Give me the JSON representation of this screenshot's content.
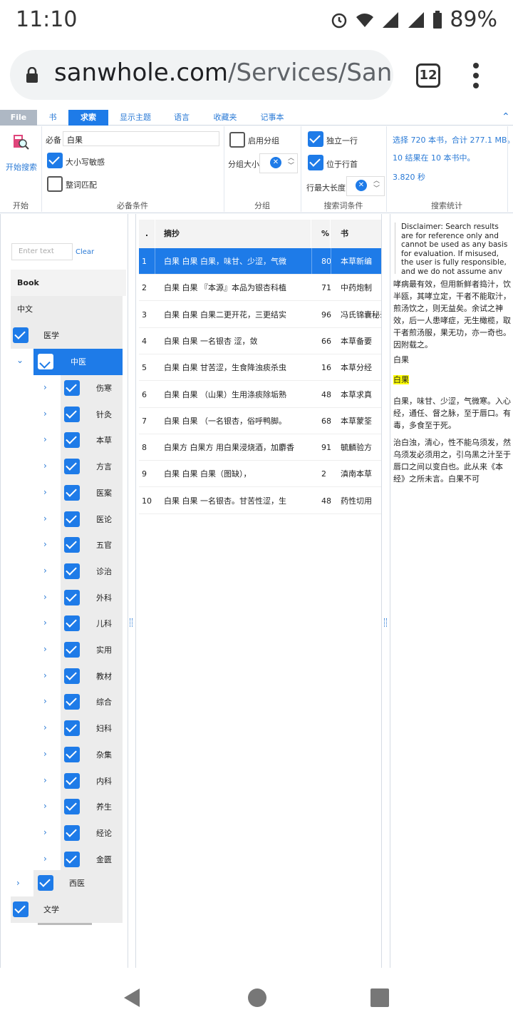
{
  "status": {
    "time": "11:10",
    "battery": "89%"
  },
  "browser": {
    "url_host": "sanwhole.com",
    "url_path": "/Services/San",
    "tab_count": "12"
  },
  "ribbon": {
    "tabs": [
      "File",
      "书",
      "求索",
      "显示主题",
      "语言",
      "收藏夹",
      "记事本"
    ],
    "start": {
      "button_label": "开始搜索",
      "group_label": "开始"
    },
    "required": {
      "field_label": "必备",
      "field_value": "白果",
      "case_sensitive": "大小写敏感",
      "whole_word": "整词匹配",
      "group_label": "必备条件"
    },
    "grouping": {
      "enable": "启用分组",
      "size_label": "分组大小",
      "group_label": "分组"
    },
    "search_cond": {
      "own_line": "独立一行",
      "line_start": "位于行首",
      "max_len": "行最大长度",
      "group_label": "搜索词条件"
    },
    "stats": {
      "line1": "选择 720 本书，合计 277.1 MB。",
      "line2": "10 结果在 10 本书中。",
      "line3": "3.820 秒",
      "group_label": "搜索统计"
    }
  },
  "tree": {
    "filter_placeholder": "Enter text",
    "clear": "Clear",
    "header": "Book",
    "lang": "中文",
    "medicine": "医学",
    "tcm": "中医",
    "tcm_children": [
      "伤寒",
      "针灸",
      "本草",
      "方言",
      "医案",
      "医论",
      "五官",
      "诊治",
      "外科",
      "儿科",
      "实用",
      "教材",
      "综合",
      "妇科",
      "杂集",
      "内科",
      "养生",
      "经论",
      "金匮"
    ],
    "western": "西医",
    "literature": "文学"
  },
  "results": {
    "headers": {
      "idx": ".",
      "excerpt": "摘抄",
      "pct": "%",
      "book": "书"
    },
    "rows": [
      {
        "n": "1",
        "excerpt": "白果 白果 白果，味甘、少涩，气微",
        "pct": "80",
        "book": "本草新编"
      },
      {
        "n": "2",
        "excerpt": "白果 白果 『本源』本品为银杏科植",
        "pct": "71",
        "book": "中药炮制"
      },
      {
        "n": "3",
        "excerpt": "白果 白果 白果二更开花，三更结实",
        "pct": "96",
        "book": "冯氏锦囊秘录"
      },
      {
        "n": "4",
        "excerpt": "白果 白果 一名银杏 涩，敛",
        "pct": "66",
        "book": "本草备要"
      },
      {
        "n": "5",
        "excerpt": "白果 白果 甘苦涩，生食降浊痰杀虫",
        "pct": "16",
        "book": "本草分经"
      },
      {
        "n": "6",
        "excerpt": "白果 白果 （山果）生用涤痰除垢熟",
        "pct": "48",
        "book": "本草求真"
      },
      {
        "n": "7",
        "excerpt": "白果 白果 （一名银杏，俗呼鸭脚。",
        "pct": "68",
        "book": "本草蒙筌"
      },
      {
        "n": "8",
        "excerpt": "白果方 白果方 用白果浸烧酒，加麝香",
        "pct": "91",
        "book": "毓麟验方"
      },
      {
        "n": "9",
        "excerpt": "白果 白果 白果（图缺），",
        "pct": "2",
        "book": "滇南本草"
      },
      {
        "n": "10",
        "excerpt": "白果 白果 一名银杏。甘苦性涩，生",
        "pct": "48",
        "book": "药性切用"
      }
    ]
  },
  "reader": {
    "disclaimer": "Disclaimer: Search results are for reference only and cannot be used as any basis for evaluation. If misused, the user is fully responsible, and we do not assume any responsibility.",
    "para1": "哮病最有效，但用新鲜者捣汁，饮半瓯，其哮立定，干者不能取汁，煎汤饮之，则无益矣。余试之神效，后一人患哮症，无生橄榄，取干者煎汤服，果无功，亦一奇也。因附载之。",
    "para2": "白果",
    "para3": "白果",
    "para4": "白果，味甘、少涩，气微寒。入心经，通任、督之脉，至于唇口。有毒，多食至于死。",
    "para5": "治白浊，清心，性不能乌须发，然乌须发必须用之，引乌黑之汁至于唇口之间以变白也。此从来《本经》之所未言。白果不可"
  }
}
